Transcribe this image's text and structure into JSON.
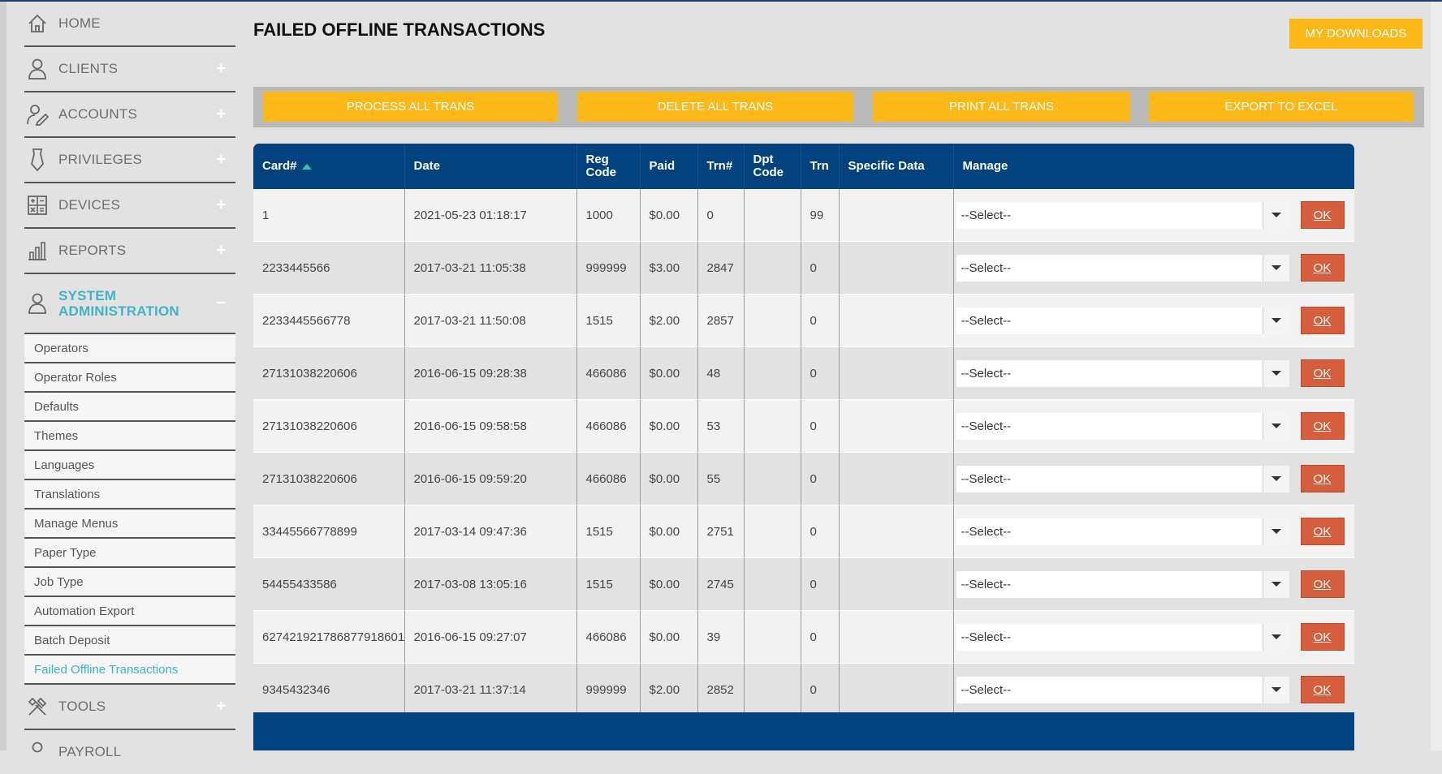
{
  "sidebar": {
    "items": [
      {
        "label": "HOME",
        "icon": "home-icon",
        "expand": ""
      },
      {
        "label": "CLIENTS",
        "icon": "user-icon",
        "expand": "+"
      },
      {
        "label": "ACCOUNTS",
        "icon": "account-icon",
        "expand": "+"
      },
      {
        "label": "PRIVILEGES",
        "icon": "privileges-icon",
        "expand": "+"
      },
      {
        "label": "DEVICES",
        "icon": "calculator-icon",
        "expand": "+"
      },
      {
        "label": "REPORTS",
        "icon": "bar-chart-icon",
        "expand": "+"
      },
      {
        "label": "SYSTEM ADMINISTRATION",
        "icon": "admin-user-icon",
        "expand": "−"
      },
      {
        "label": "TOOLS",
        "icon": "tools-icon",
        "expand": "+"
      },
      {
        "label": "PAYROLL",
        "icon": "payroll-icon",
        "expand": ""
      }
    ],
    "sub_items": [
      "Operators",
      "Operator Roles",
      "Defaults",
      "Themes",
      "Languages",
      "Translations",
      "Manage Menus",
      "Paper Type",
      "Job Type",
      "Automation Export",
      "Batch Deposit",
      "Failed Offline Transactions"
    ],
    "active_color": "#3fb3c8"
  },
  "page": {
    "title": "FAILED OFFLINE TRANSACTIONS",
    "downloads_label": "MY DOWNLOADS"
  },
  "toolbar": {
    "process_label": "PROCESS ALL TRANS",
    "delete_label": "DELETE ALL TRANS",
    "print_label": "PRINT ALL TRANS",
    "export_label": "EXPORT TO EXCEL"
  },
  "table": {
    "headers": {
      "card": "Card#",
      "date": "Date",
      "reg_code": "Reg Code",
      "paid": "Paid",
      "trn_no": "Trn#",
      "dpt_code": "Dpt Code",
      "trn": "Trn",
      "specific": "Specific Data",
      "manage": "Manage"
    },
    "select_placeholder": "--Select--",
    "ok_label": "OK",
    "rows": [
      {
        "card": "1",
        "date": "2021-05-23 01:18:17",
        "reg": "1000",
        "paid": "$0.00",
        "trnno": "0",
        "dpt": "",
        "trn": "99",
        "spec": ""
      },
      {
        "card": "2233445566",
        "date": "2017-03-21 11:05:38",
        "reg": "999999",
        "paid": "$3.00",
        "trnno": "2847",
        "dpt": "",
        "trn": "0",
        "spec": ""
      },
      {
        "card": "2233445566778",
        "date": "2017-03-21 11:50:08",
        "reg": "1515",
        "paid": "$2.00",
        "trnno": "2857",
        "dpt": "",
        "trn": "0",
        "spec": ""
      },
      {
        "card": "27131038220606",
        "date": "2016-06-15 09:28:38",
        "reg": "466086",
        "paid": "$0.00",
        "trnno": "48",
        "dpt": "",
        "trn": "0",
        "spec": ""
      },
      {
        "card": "27131038220606",
        "date": "2016-06-15 09:58:58",
        "reg": "466086",
        "paid": "$0.00",
        "trnno": "53",
        "dpt": "",
        "trn": "0",
        "spec": ""
      },
      {
        "card": "27131038220606",
        "date": "2016-06-15 09:59:20",
        "reg": "466086",
        "paid": "$0.00",
        "trnno": "55",
        "dpt": "",
        "trn": "0",
        "spec": ""
      },
      {
        "card": "33445566778899",
        "date": "2017-03-14 09:47:36",
        "reg": "1515",
        "paid": "$0.00",
        "trnno": "2751",
        "dpt": "",
        "trn": "0",
        "spec": ""
      },
      {
        "card": "54455433586",
        "date": "2017-03-08 13:05:16",
        "reg": "1515",
        "paid": "$0.00",
        "trnno": "2745",
        "dpt": "",
        "trn": "0",
        "spec": ""
      },
      {
        "card": "627421921786877918601",
        "date": "2016-06-15 09:27:07",
        "reg": "466086",
        "paid": "$0.00",
        "trnno": "39",
        "dpt": "",
        "trn": "0",
        "spec": ""
      },
      {
        "card": "9345432346",
        "date": "2017-03-21 11:37:14",
        "reg": "999999",
        "paid": "$2.00",
        "trnno": "2852",
        "dpt": "",
        "trn": "0",
        "spec": ""
      }
    ]
  },
  "colors": {
    "header_blue": "#01427f",
    "button_yellow": "#fcb817",
    "ok_red": "#d65e3c"
  }
}
